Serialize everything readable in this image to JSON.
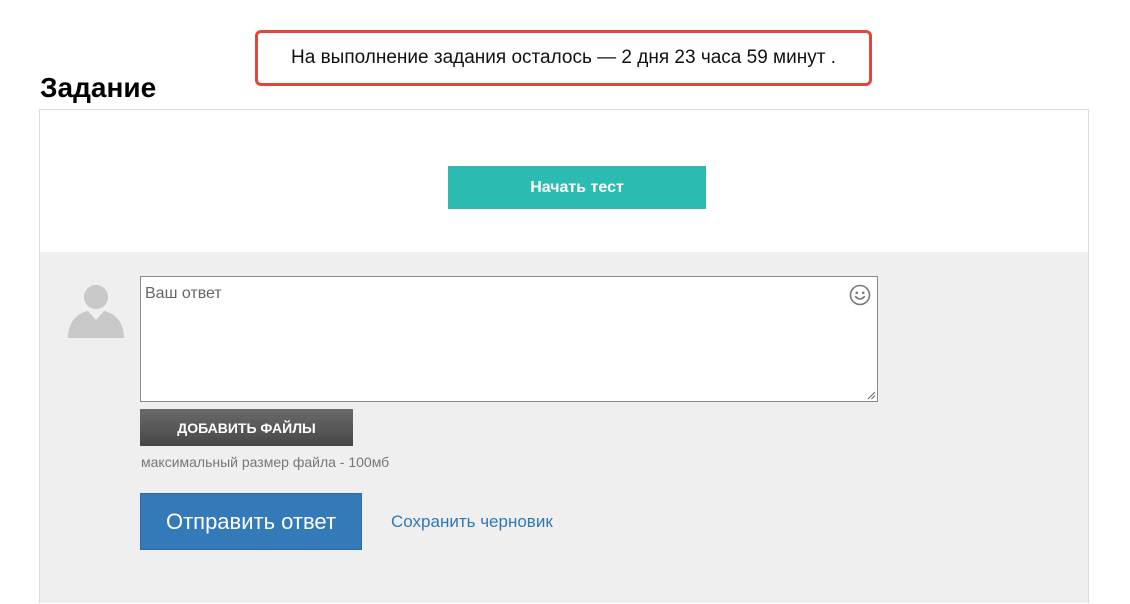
{
  "deadline": {
    "text": "На выполнение задания осталось — 2 дня 23 часа 59 минут ."
  },
  "task": {
    "title": "Задание",
    "start_test_label": "Начать тест"
  },
  "answer": {
    "placeholder": "Ваш ответ",
    "add_files_label": "ДОБАВИТЬ ФАЙЛЫ",
    "file_size_note": "максимальный размер файла - 100мб",
    "submit_label": "Отправить ответ",
    "save_draft_label": "Сохранить черновик"
  },
  "colors": {
    "banner_border": "#e0463a",
    "start_button": "#2bbbb0",
    "submit_button": "#3479b8",
    "link": "#2f78b4",
    "answer_panel_bg": "#efefef"
  },
  "icons": {
    "avatar": "user-silhouette-icon",
    "emoji": "smiley-icon",
    "resize": "resize-grip-icon"
  }
}
